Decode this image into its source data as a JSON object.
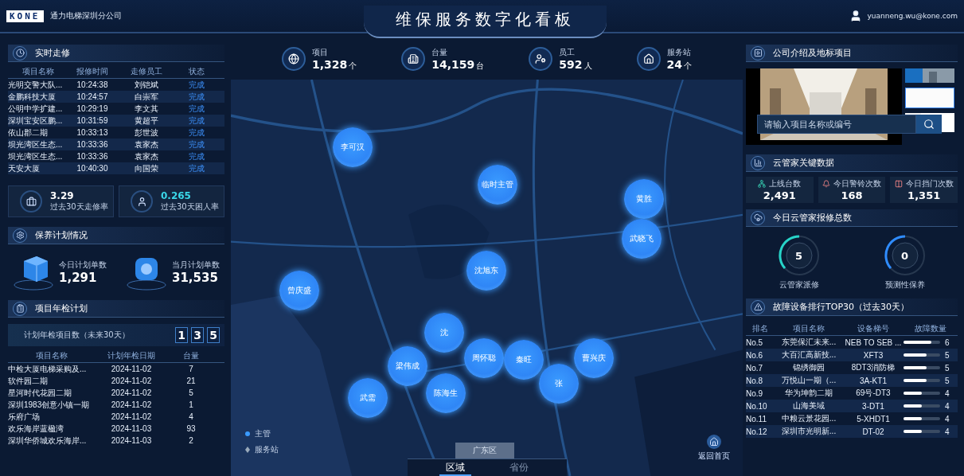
{
  "header": {
    "logo": "KONE",
    "company": "通力电梯深圳分公司",
    "title": "维保服务数字化看板",
    "user": "yuanneng.wu@kone.com"
  },
  "repairs": {
    "title": "实时走修",
    "columns": [
      "项目名称",
      "报修时间",
      "走修员工",
      "状态"
    ],
    "rows": [
      [
        "光明交警大队...",
        "10:24:38",
        "刘铠斌",
        "完成"
      ],
      [
        "金鹏科技大厦",
        "10:24:57",
        "白崇军",
        "完成"
      ],
      [
        "公明中学扩建...",
        "10:29:19",
        "李文其",
        "完成"
      ],
      [
        "深圳宝安区鹏...",
        "10:31:59",
        "黄超平",
        "完成"
      ],
      [
        "依山郡二期",
        "10:33:13",
        "彭世波",
        "完成"
      ],
      [
        "坝光湾区生态...",
        "10:33:36",
        "袁家杰",
        "完成"
      ],
      [
        "坝光湾区生态...",
        "10:33:36",
        "袁家杰",
        "完成"
      ],
      [
        "天安大厦",
        "10:40:30",
        "向国荣",
        "完成"
      ]
    ],
    "kpis": [
      {
        "value": "3.29",
        "label": "过去30天走修率",
        "color": "#ffffff",
        "kind": "case"
      },
      {
        "value": "0.265",
        "label": "过去30天困人率",
        "color": "#3ad6e8",
        "kind": "person"
      }
    ]
  },
  "maintenance": {
    "title": "保养计划情况",
    "items": [
      {
        "label": "今日计划单数",
        "value": "1,291",
        "kind": "box"
      },
      {
        "label": "当月计划单数",
        "value": "31,535",
        "kind": "disc"
      }
    ]
  },
  "inspection": {
    "title": "项目年检计划",
    "count_label": "计划年检项目数（未来30天）",
    "digits": [
      "1",
      "3",
      "5"
    ],
    "columns": [
      "项目名称",
      "计划年检日期",
      "台量"
    ],
    "rows": [
      [
        "中检大厦电梯采购及...",
        "2024-11-02",
        "7"
      ],
      [
        "软件园二期",
        "2024-11-02",
        "21"
      ],
      [
        "星河时代花园二期",
        "2024-11-02",
        "5"
      ],
      [
        "深圳1983创意小镇一期",
        "2024-11-02",
        "1"
      ],
      [
        "乐府广场",
        "2024-11-02",
        "4"
      ],
      [
        "欢乐海岸蓝楹湾",
        "2024-11-03",
        "93"
      ],
      [
        "深圳华侨城欢乐海岸...",
        "2024-11-03",
        "2"
      ]
    ]
  },
  "stats": [
    {
      "label": "项目",
      "value": "1,328",
      "unit": "个",
      "kind": "globe"
    },
    {
      "label": "台量",
      "value": "14,159",
      "unit": "台",
      "kind": "building"
    },
    {
      "label": "员工",
      "value": "592",
      "unit": "人",
      "kind": "staff"
    },
    {
      "label": "服务站",
      "value": "24",
      "unit": "个",
      "kind": "home"
    }
  ],
  "map": {
    "markers": [
      {
        "label": "沈"
      },
      {
        "label": "李可汉"
      },
      {
        "label": "临时主管"
      },
      {
        "label": "黄胜"
      },
      {
        "label": "武晓飞"
      },
      {
        "label": "沈旭东"
      },
      {
        "label": "曾庆盛"
      },
      {
        "label": "梁伟成"
      },
      {
        "label": "陈海生"
      },
      {
        "label": "周怀聪"
      },
      {
        "label": "秦旺"
      },
      {
        "label": "张"
      },
      {
        "label": "曹兴庆"
      },
      {
        "label": "武需"
      }
    ],
    "legend": [
      {
        "label": "主管",
        "kind": "dot"
      },
      {
        "label": "服务站",
        "kind": "diamond"
      }
    ],
    "region_tag": "广东区",
    "home_button": "返回首页",
    "tabs": [
      {
        "label": "区域",
        "selected": true
      },
      {
        "label": "省份",
        "selected": false
      }
    ]
  },
  "intro": {
    "title": "公司介绍及地标项目",
    "search": {
      "placeholder": "请输入项目名称或编号"
    }
  },
  "cloud": {
    "title": "云管家关键数据",
    "items": [
      {
        "label": "上线台数",
        "value": "2,491",
        "kind": "elevator"
      },
      {
        "label": "今日警铃次数",
        "value": "168",
        "kind": "bell"
      },
      {
        "label": "今日挡门次数",
        "value": "1,351",
        "kind": "door"
      }
    ]
  },
  "cloud_repairs": {
    "title": "今日云管家报修总数",
    "items": [
      {
        "value": "5",
        "label": "云管家派修",
        "color": "#27d3c8"
      },
      {
        "value": "0",
        "label": "预测性保养",
        "color": "#2f8cff"
      }
    ]
  },
  "ranking": {
    "title": "故障设备排行TOP30（过去30天）",
    "columns": [
      "排名",
      "项目名称",
      "设备梯号",
      "故障数量"
    ],
    "rows": [
      {
        "rank": "No.5",
        "name": "东莞保汇未来...",
        "device": "NEB TO SEB ...",
        "count": "6",
        "level": 0.75
      },
      {
        "rank": "No.6",
        "name": "大百汇高新技...",
        "device": "XFT3",
        "count": "5",
        "level": 0.62
      },
      {
        "rank": "No.7",
        "name": "锦绣御园",
        "device": "8DT3消防梯",
        "count": "5",
        "level": 0.62
      },
      {
        "rank": "No.8",
        "name": "万悦山一期（...",
        "device": "3A-KT1",
        "count": "5",
        "level": 0.62
      },
      {
        "rank": "No.9",
        "name": "华为坤韵二期",
        "device": "69号-DT3",
        "count": "4",
        "level": 0.5
      },
      {
        "rank": "No.10",
        "name": "山海美域",
        "device": "3-DT1",
        "count": "4",
        "level": 0.5
      },
      {
        "rank": "No.11",
        "name": "中粮云景花园...",
        "device": "5-XHDT1",
        "count": "4",
        "level": 0.5
      },
      {
        "rank": "No.12",
        "name": "深圳市光明新...",
        "device": "DT-02",
        "count": "4",
        "level": 0.5
      }
    ]
  }
}
